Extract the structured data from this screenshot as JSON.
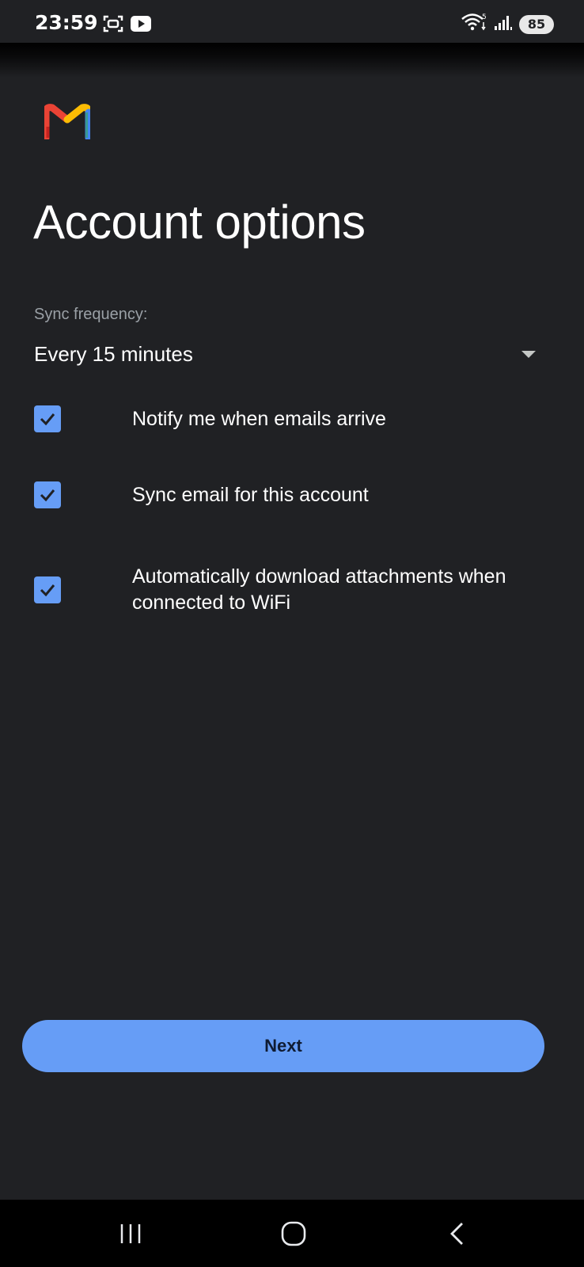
{
  "status_bar": {
    "time": "23:59",
    "battery": "85",
    "icons_left": [
      "screenshot-icon",
      "youtube-icon"
    ],
    "icons_right": [
      "wifi-icon",
      "signal-icon",
      "battery-icon"
    ]
  },
  "app": {
    "logo": "gmail-logo",
    "title": "Account options"
  },
  "sync": {
    "label": "Sync frequency:",
    "value": "Every 15 minutes"
  },
  "options": [
    {
      "label": "Notify me when emails arrive",
      "checked": true
    },
    {
      "label": "Sync email for this account",
      "checked": true
    },
    {
      "label": "Automatically download attachments when connected to WiFi",
      "checked": true
    }
  ],
  "actions": {
    "next_label": "Next"
  },
  "nav_bar": {
    "buttons": [
      "recents-icon",
      "home-icon",
      "back-icon"
    ]
  },
  "colors": {
    "background": "#202124",
    "accent": "#669df6",
    "text_primary": "#ffffff",
    "text_secondary": "#9aa0a6"
  }
}
